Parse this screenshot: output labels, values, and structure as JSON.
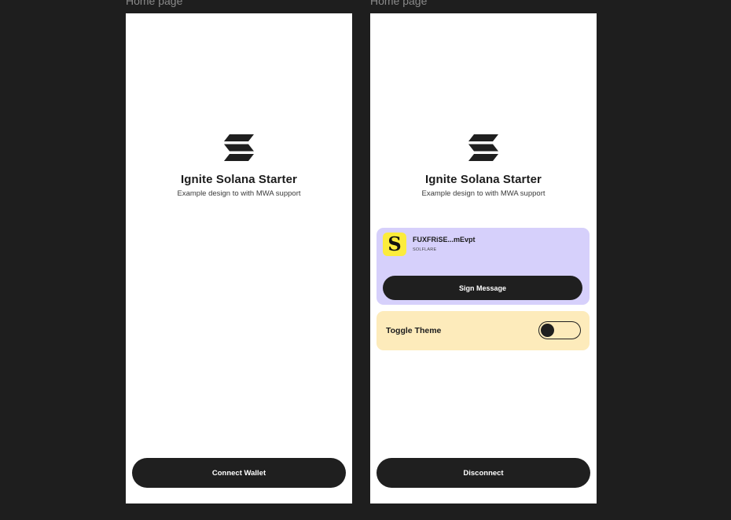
{
  "frames": [
    {
      "label": "Home page",
      "title": "Ignite Solana Starter",
      "subtitle": "Example design to with MWA support",
      "bottom_button": "Connect Wallet"
    },
    {
      "label": "Home page",
      "title": "Ignite Solana Starter",
      "subtitle": "Example design to with MWA support",
      "wallet": {
        "address": "FUXFRiSE...mEvpt",
        "name": "SOLFLARE",
        "icon": "solflare-logo-icon"
      },
      "sign_button": "Sign Message",
      "theme_toggle": {
        "label": "Toggle Theme",
        "state": "off"
      },
      "bottom_button": "Disconnect"
    }
  ],
  "colors": {
    "canvas_background": "#1e1e1e",
    "frame_background": "#ffffff",
    "primary_button": "#1f1f1f",
    "wallet_card": "#d6d0fb",
    "theme_card": "#fdebbb",
    "wallet_icon_bg": "#fcec3c"
  },
  "icons": {
    "app_logo": "solana-logo-icon"
  }
}
